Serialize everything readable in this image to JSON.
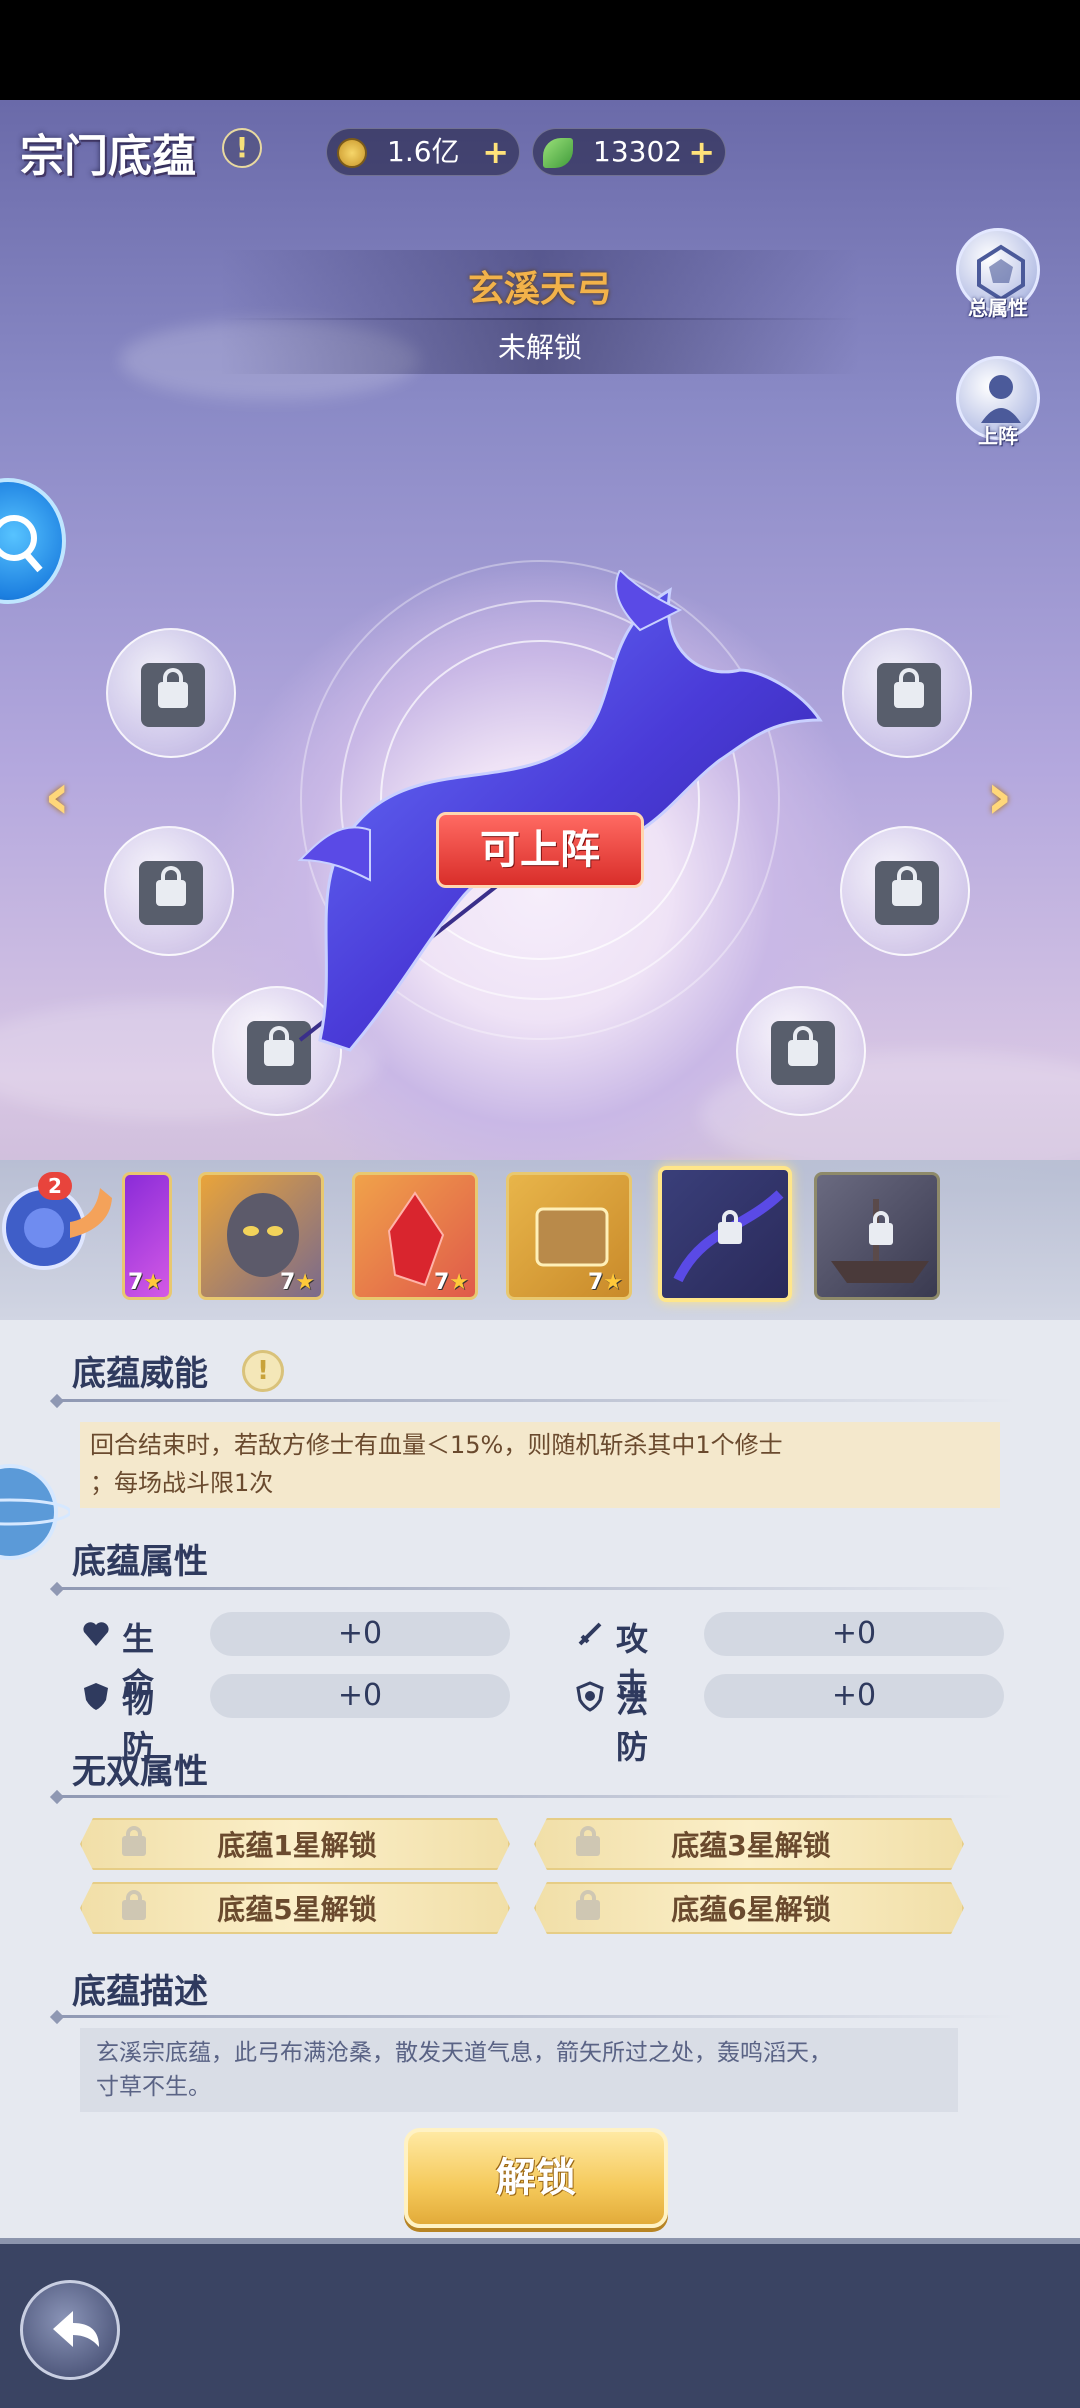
{
  "header": {
    "title": "宗门底蕴",
    "help_symbol": "!",
    "coins": "1.6亿",
    "jade": "13302",
    "plus_symbol": "+"
  },
  "item": {
    "name": "玄溪天弓",
    "status": "未解锁",
    "deploy_badge": "可上阵"
  },
  "side_buttons": {
    "total_attributes": "总属性",
    "deploy": "上阵"
  },
  "navigation": {
    "prev": "‹",
    "next": "›"
  },
  "snail_badge": "2",
  "cards": [
    {
      "stars": "7",
      "locked": false
    },
    {
      "stars": "7",
      "locked": false
    },
    {
      "stars": "7",
      "locked": false
    },
    {
      "stars": "7",
      "locked": false
    },
    {
      "stars": "",
      "locked": true
    },
    {
      "stars": "",
      "locked": true
    }
  ],
  "sections": {
    "power_title": "底蕴威能",
    "power_text_line1": "回合结束时，若敌方修士有血量＜15%，则随机斩杀其中1个修士",
    "power_text_line2": "；每场战斗限1次",
    "attributes_title": "底蕴属性",
    "unique_title": "无双属性",
    "description_title": "底蕴描述",
    "description_line1": "玄溪宗底蕴，此弓布满沧桑，散发天道气息，箭矢所过之处，轰鸣滔天，",
    "description_line2": "寸草不生。"
  },
  "attributes": {
    "hp_label": "生命",
    "hp_value": "+0",
    "atk_label": "攻击",
    "atk_value": "+0",
    "pdef_label": "物防",
    "pdef_value": "+0",
    "mdef_label": "法防",
    "mdef_value": "+0"
  },
  "unique": {
    "star1": "底蕴1星解锁",
    "star3": "底蕴3星解锁",
    "star5": "底蕴5星解锁",
    "star6": "底蕴6星解锁"
  },
  "footer": {
    "unlock_button": "解锁"
  },
  "colors": {
    "accent_gold": "#f2b24a",
    "badge_red": "#d92e2a",
    "panel_bg": "#e6e9f0",
    "text_dark": "#2f3a5e"
  }
}
